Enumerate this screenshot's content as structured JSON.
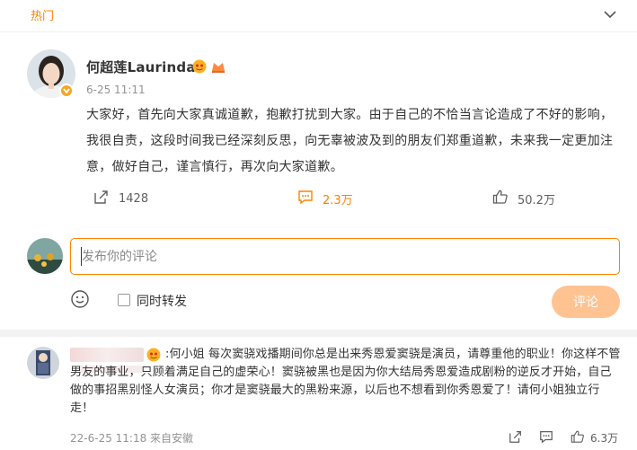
{
  "header": {
    "tab_label": "热门",
    "collapse_icon": "chevron-down-icon"
  },
  "post": {
    "author": "何超莲Laurinda",
    "time": "6-25 11:11",
    "text": "大家好，首先向大家真诚道歉，抱歉打扰到大家。由于自己的不恰当言论造成了不好的影响，我很自责，这段时间我已经深刻反思，向无辜被波及到的朋友们郑重道歉，未来我一定更加注意，做好自己，谨言慎行，再次向大家道歉。",
    "repost_count": "1428",
    "comment_count": "2.3万",
    "like_count": "50.2万",
    "accent_color": "#ff8200"
  },
  "composer": {
    "placeholder": "发布你的评论",
    "repost_label": "同时转发",
    "submit_label": "评论"
  },
  "comment": {
    "text": ":何小姐 每次窦骁戏播期间你总是出来秀恩爱窦骁是演员，请尊重他的职业！你这样不管男友的事业，只顾着满足自己的虚荣心！窦骁被黑也是因为你大结局秀恩爱造成剧粉的逆反才开始，自己做的事招黑别怪人女演员；你才是窦骁最大的黑粉来源，以后也不想看到你秀恩爱了！请何小姐独立行走！",
    "meta": "22-6-25 11:18 来自安徽",
    "like_count": "6.3万"
  }
}
